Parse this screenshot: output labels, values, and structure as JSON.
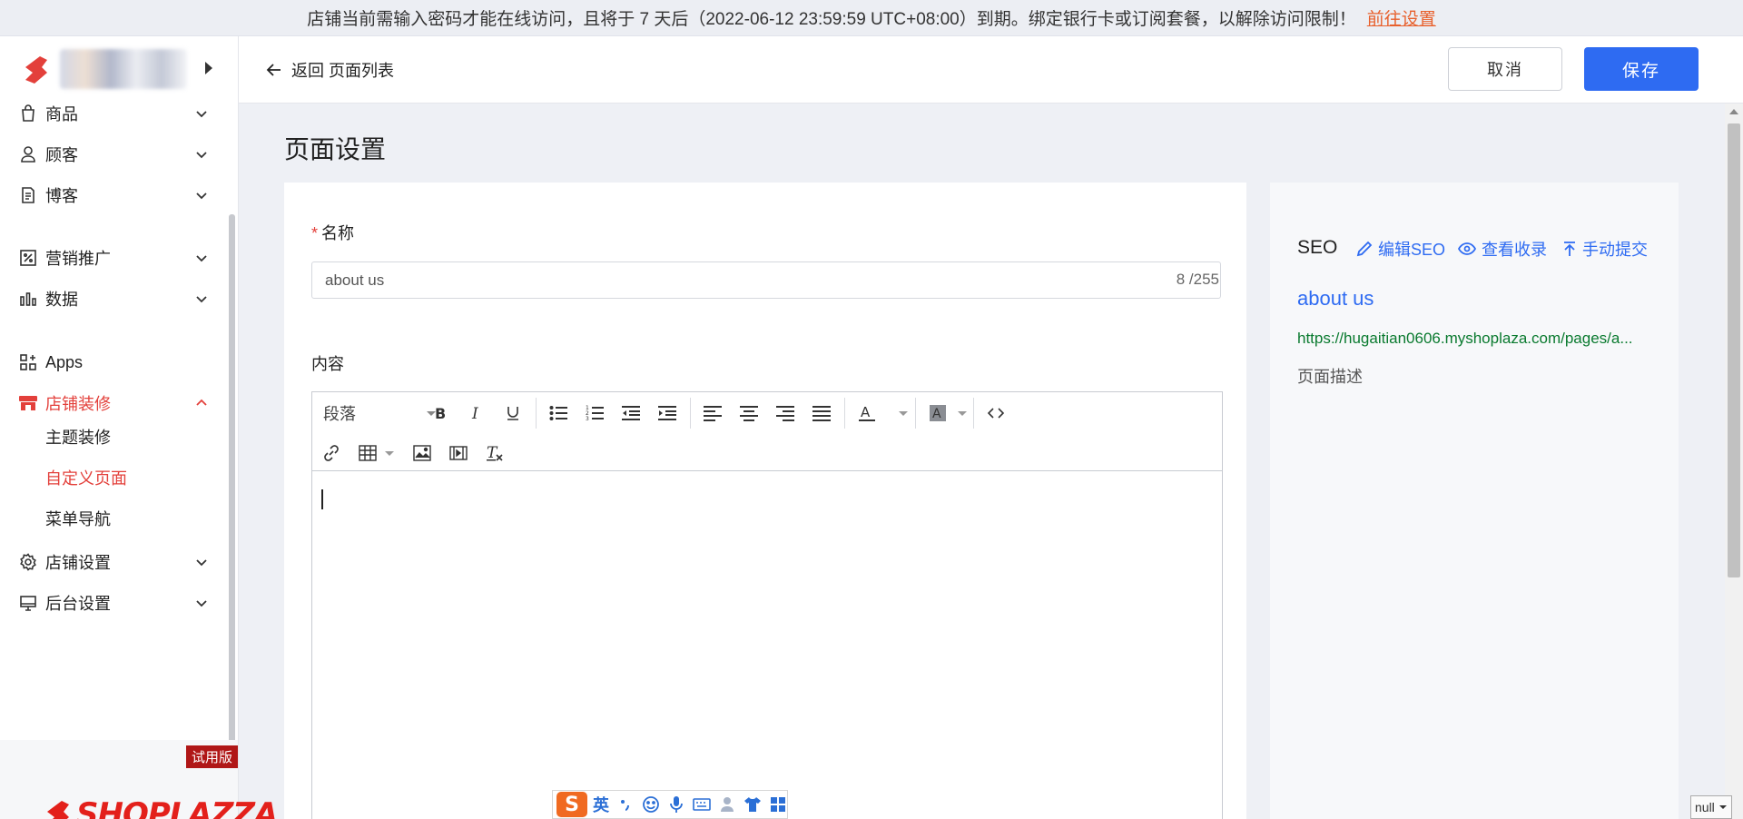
{
  "banner": {
    "message": "店铺当前需输入密码才能在线访问，且将于 7 天后（2022-06-12 23:59:59 UTC+08:00）到期。绑定银行卡或订阅套餐，以解除访问限制！",
    "link": "前往设置"
  },
  "sidebar": {
    "items": [
      {
        "label": "商品",
        "icon": "bag-icon"
      },
      {
        "label": "顾客",
        "icon": "user-icon"
      },
      {
        "label": "博客",
        "icon": "document-icon"
      },
      {
        "label": "营销推广",
        "icon": "discount-icon"
      },
      {
        "label": "数据",
        "icon": "bar-chart-icon"
      },
      {
        "label": "Apps",
        "icon": "apps-icon"
      },
      {
        "label": "店铺装修",
        "icon": "store-icon"
      },
      {
        "label": "店铺设置",
        "icon": "gear-icon"
      },
      {
        "label": "后台设置",
        "icon": "monitor-icon"
      }
    ],
    "subitems": [
      "主题装修",
      "自定义页面",
      "菜单导航"
    ],
    "trial_badge": "试用版",
    "brand": "SHOPLAZZA"
  },
  "header": {
    "back_label": "返回 页面列表",
    "cancel_label": "取消",
    "save_label": "保存"
  },
  "page": {
    "title": "页面设置",
    "name_label": "名称",
    "name_value": "about us",
    "name_counter": "8 /255",
    "content_label": "内容",
    "paragraph_select": "段落"
  },
  "seo": {
    "title": "SEO",
    "edit_label": "编辑SEO",
    "view_label": "查看收录",
    "submit_label": "手动提交",
    "page_title": "about us",
    "url": "https://hugaitian0606.myshoplaza.com/pages/a...",
    "description": "页面描述"
  },
  "ime": {
    "lang": "英"
  },
  "misc": {
    "null_tag": "null"
  },
  "colors": {
    "accent": "#2e6bf2",
    "brand_red": "#e3403b",
    "url_green": "#0a7a2f",
    "banner_link": "#e8602c"
  }
}
